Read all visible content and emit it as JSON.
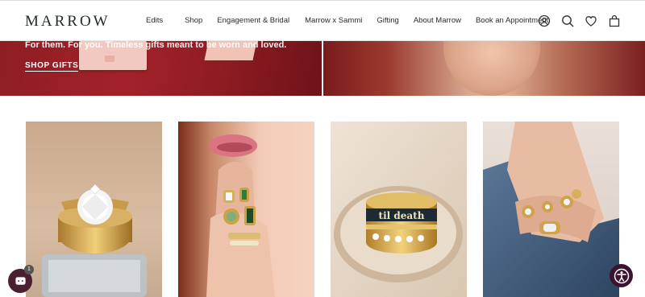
{
  "brand": {
    "logo_text": "MARROW"
  },
  "nav": {
    "items": [
      {
        "label": "Edits"
      },
      {
        "label": "Shop"
      },
      {
        "label": "Engagement & Bridal"
      },
      {
        "label": "Marrow x Sammi"
      },
      {
        "label": "Gifting"
      },
      {
        "label": "About Marrow"
      },
      {
        "label": "Book an Appointment"
      }
    ]
  },
  "header_icons": [
    "account-icon",
    "search-icon",
    "heart-icon",
    "bag-icon"
  ],
  "hero": {
    "subtitle": "For them. For you. Timeless gifts meant to be worn and loved.",
    "cta_label": "SHOP GIFTS"
  },
  "products": [
    {
      "image": "engagement-ring-photo"
    },
    {
      "image": "model-with-rings-photo"
    },
    {
      "image": "til-death-ring-stack-photo"
    },
    {
      "image": "hand-in-pocket-rings-photo"
    }
  ],
  "ring_engraving": "til death",
  "chat": {
    "badge_count": "1"
  },
  "colors": {
    "hero_red": "#9e2027",
    "chat_button": "#4a2030",
    "accessibility_button": "#3b1530"
  }
}
